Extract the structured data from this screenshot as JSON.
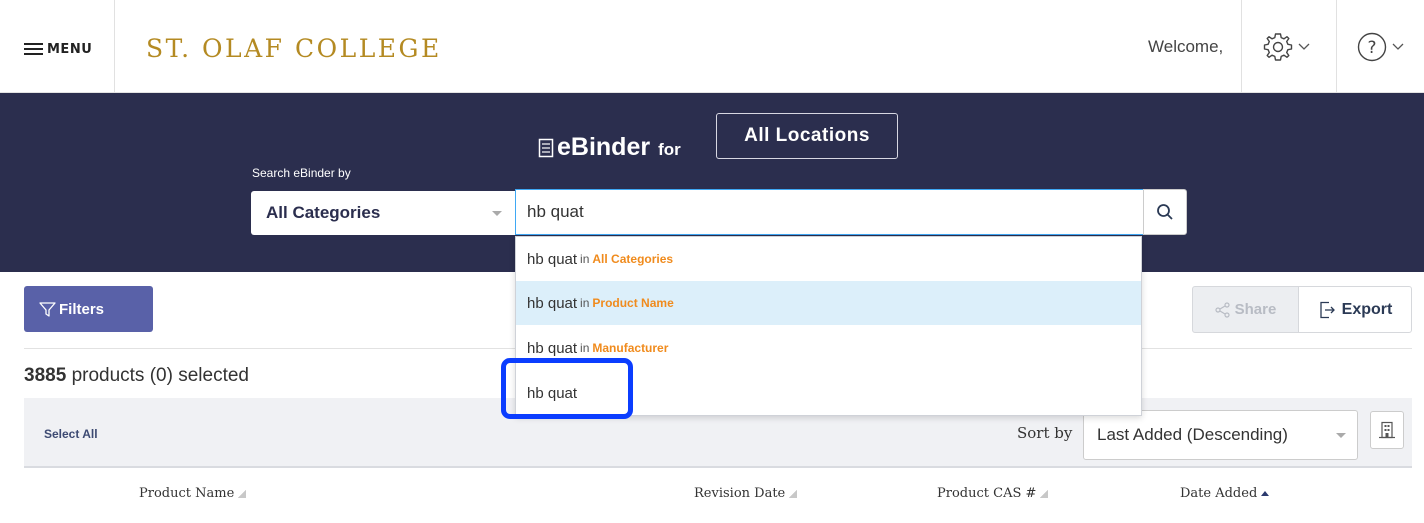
{
  "header": {
    "menu_label": "MENU",
    "logo_text": "ST. OLAF COLLEGE",
    "welcome_text": "Welcome,",
    "settings_icon": "gear-icon",
    "help_icon": "question-circle-icon"
  },
  "banner": {
    "brand_icon": "binder-icon",
    "brand_name": "eBinder",
    "brand_for": "for",
    "location_button": "All Locations",
    "search_by_label": "Search eBinder by",
    "category_select_value": "All Categories",
    "search_input_value": "hb quat"
  },
  "autocomplete": {
    "in_word": "in",
    "items": [
      {
        "query": "hb quat",
        "category": "All Categories"
      },
      {
        "query": "hb quat",
        "category": "Product Name",
        "highlighted": true
      },
      {
        "query": "hb quat",
        "category": "Manufacturer"
      },
      {
        "query": "hb quat",
        "category": ""
      }
    ]
  },
  "toolbar": {
    "filters_label": "Filters",
    "share_label": "Share",
    "export_label": "Export"
  },
  "summary": {
    "count": "3885",
    "text": "products (0) selected"
  },
  "table": {
    "select_all": "Select All",
    "sort_by_label": "Sort by",
    "sort_value": "Last Added (Descending)",
    "columns": [
      "Product Name",
      "Revision Date",
      "Product CAS #",
      "Date Added"
    ]
  },
  "colors": {
    "banner_bg": "#2b2e4e",
    "logo_gold": "#b48a22",
    "filters_btn": "#5961a8",
    "category_orange": "#f08b1d",
    "highlight_row": "#dceffa",
    "focus_ring": "#0b3dff"
  }
}
